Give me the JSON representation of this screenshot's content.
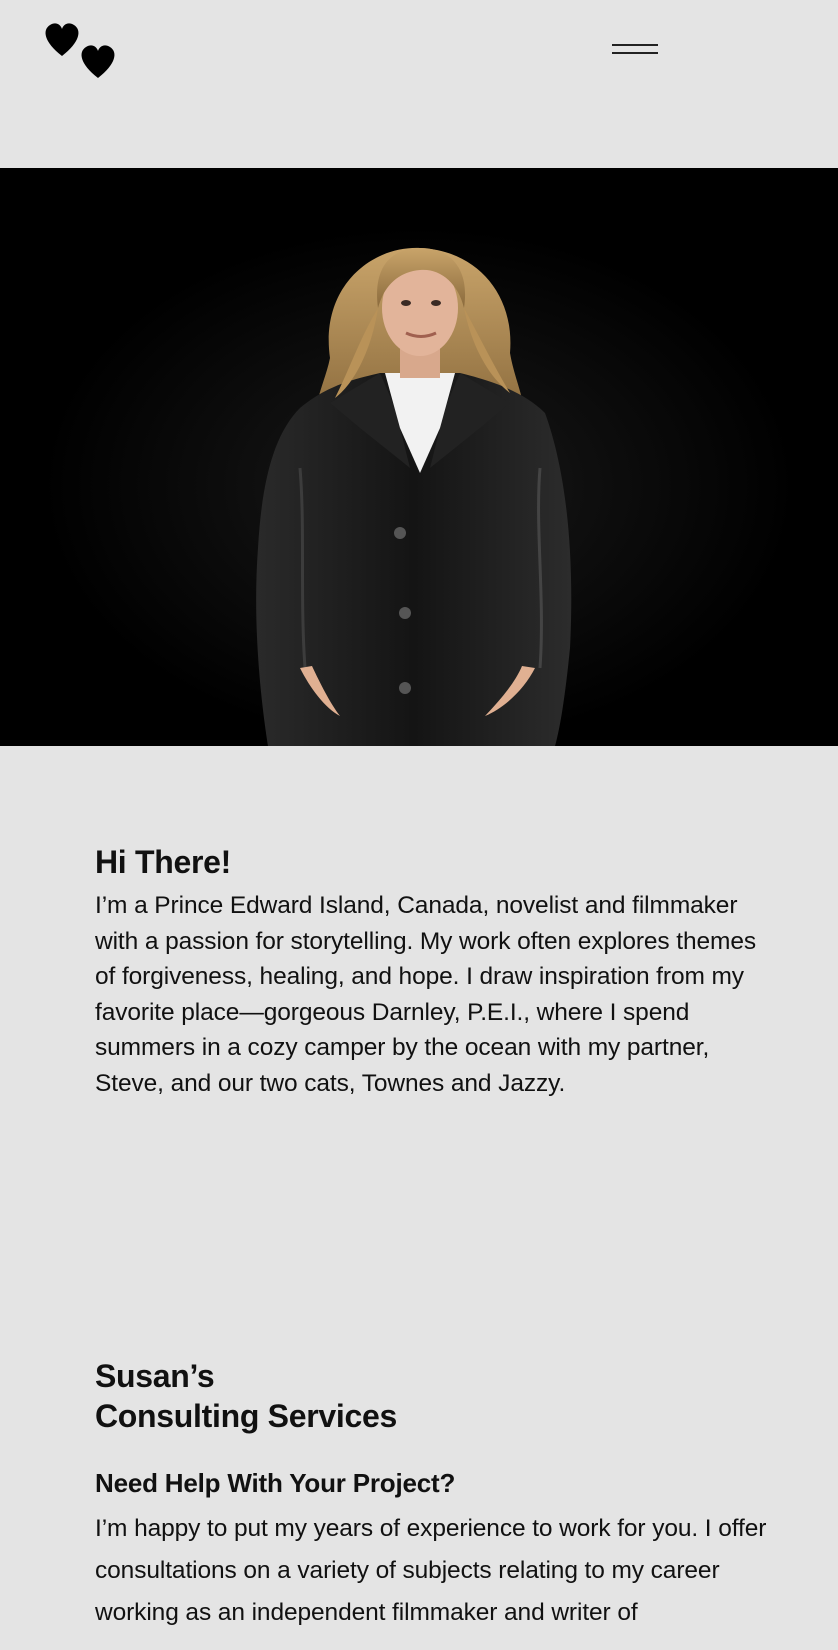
{
  "header": {
    "logo_icon": "double-heart-logo",
    "menu_icon": "hamburger-menu-icon"
  },
  "hero": {
    "image": "portrait-woman-leather-jacket",
    "background": "#000000"
  },
  "intro": {
    "heading": "Hi There!",
    "body": "I’m a Prince Edward Island, Canada, novelist and filmmaker with a passion for storytelling. My work often explores themes of forgiveness, healing, and hope. I draw inspiration from my favorite place—gorgeous Darnley, P.E.I., where I spend summers in a cozy camper by the ocean with my partner, Steve, and our two cats, Townes and Jazzy."
  },
  "services": {
    "heading_line1": "Susan’s",
    "heading_line2": "Consulting Services",
    "subheading": "Need Help With Your Project?",
    "body": "I’m happy to put my years of experience to work for you. I offer consultations on a variety of subjects relating to my career working as an independent filmmaker and writer of"
  },
  "colors": {
    "page_background": "#e4e4e4",
    "text": "#111111",
    "hero_background": "#000000"
  }
}
